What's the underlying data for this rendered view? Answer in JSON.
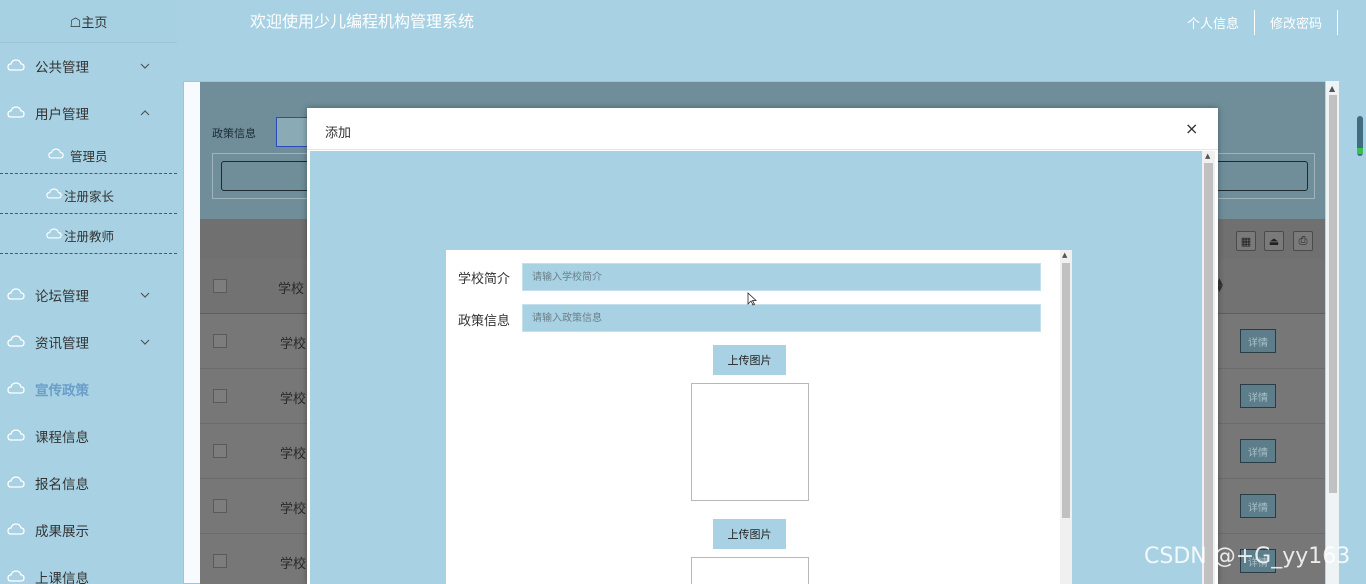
{
  "header": {
    "app_title": "欢迎使用少儿编程机构管理系统",
    "links": [
      "个人信息",
      "修改密码"
    ]
  },
  "sidebar": {
    "home": "☖主页",
    "items": [
      {
        "label": "公共管理",
        "expanded": false
      },
      {
        "label": "用户管理",
        "expanded": true,
        "children": [
          "管理员",
          "注册家长",
          "注册教师"
        ]
      },
      {
        "label": "论坛管理",
        "expanded": false
      },
      {
        "label": "资讯管理",
        "expanded": false
      },
      {
        "label": "宣传政策",
        "active": true
      },
      {
        "label": "课程信息"
      },
      {
        "label": "报名信息"
      },
      {
        "label": "成果展示"
      },
      {
        "label": "上课信息"
      }
    ]
  },
  "filter": {
    "label": "政策信息"
  },
  "table": {
    "header_col": "学校",
    "rows": [
      "学校",
      "学校",
      "学校",
      "学校",
      "学校"
    ],
    "action_label": "详情"
  },
  "modal": {
    "title": "添加",
    "close": "×",
    "fields": [
      {
        "label": "学校简介",
        "placeholder": "请输入学校简介"
      },
      {
        "label": "政策信息",
        "placeholder": "请输入政策信息"
      }
    ],
    "upload_label": "上传图片"
  },
  "watermark": "CSDN @+G_yy163",
  "colors": {
    "background": "#a8d2e4",
    "accent_active": "#6a9ec9",
    "filter_area": "#6f8e99"
  }
}
